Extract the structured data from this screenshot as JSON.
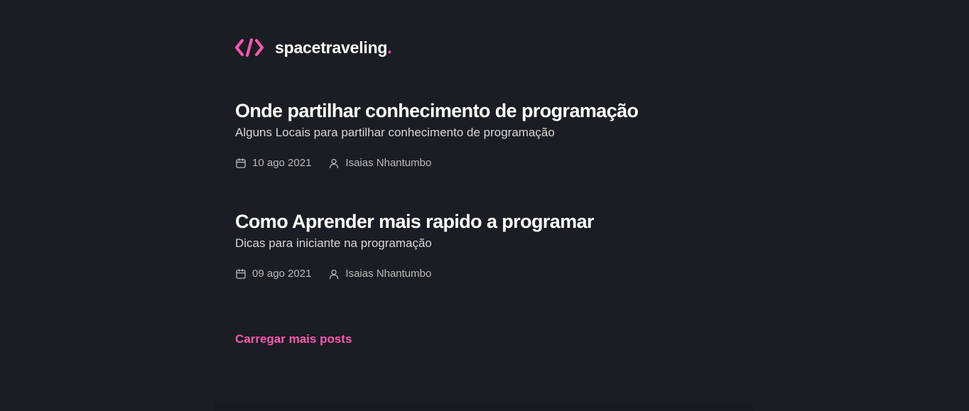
{
  "header": {
    "brand_name": "spacetraveling",
    "brand_dot": ".",
    "logo_icon": "code-brackets-icon"
  },
  "posts": [
    {
      "title": "Onde partilhar conhecimento de programação",
      "subtitle": "Alguns Locais para partilhar conhecimento de programação",
      "date": "10 ago 2021",
      "author": "Isaias Nhantumbo"
    },
    {
      "title": "Como Aprender mais rapido a programar",
      "subtitle": "Dicas para iniciante na programação",
      "date": "09 ago 2021",
      "author": "Isaias Nhantumbo"
    }
  ],
  "load_more_label": "Carregar mais posts",
  "colors": {
    "background": "#1a1d23",
    "accent": "#ff57b2",
    "heading": "#ffffff",
    "body_text": "#d7d7d7",
    "meta_text": "#bbbbbb"
  }
}
